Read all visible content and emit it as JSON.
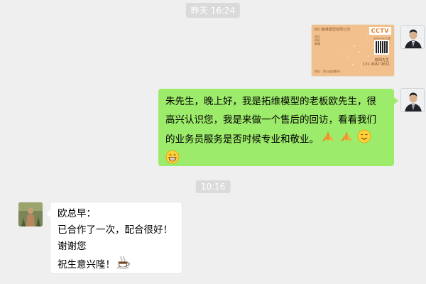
{
  "timestamps": {
    "first": "昨天 16:24",
    "second": "10:16"
  },
  "business_card": {
    "company": "四川拓维模型有限公司",
    "brand": "CCTV",
    "brand_sub": "央视合作品牌",
    "info_lines": [
      "电话",
      "网址",
      "邮箱"
    ],
    "name": "欧阳先生",
    "phone": "131 4582 9631",
    "address": "地址：四川省成都市"
  },
  "messages": {
    "outgoing": {
      "line1": "朱先生，晚上好，我是拓维模型的老板欧先生，很",
      "line2": "高兴认识您，我是来做一个售后的回访，看看我们",
      "line3": "的业务员服务是否时候专业和敬业。",
      "emojis": [
        "pray",
        "pray",
        "smile",
        "grin"
      ]
    },
    "incoming": {
      "line1": "欧总早：",
      "line2": "已合作了一次，配合很好！",
      "line3": "谢谢您",
      "line4": "祝生意兴隆！",
      "emojis": [
        "coffee"
      ]
    }
  },
  "colors": {
    "background": "#efefef",
    "outgoing_bubble": "#9deb6a",
    "incoming_bubble": "#ffffff",
    "timestamp_bg": "#dadada",
    "card_orange": "#f1c08d"
  }
}
